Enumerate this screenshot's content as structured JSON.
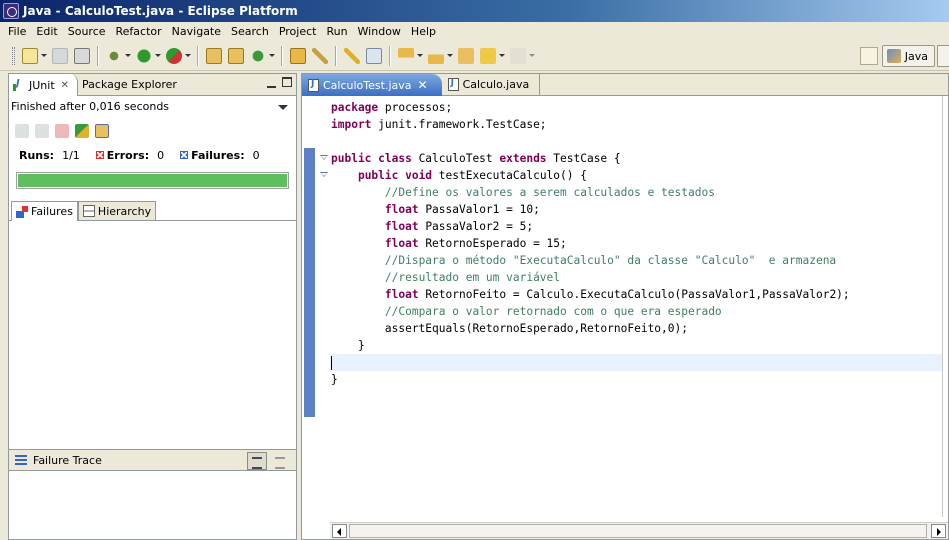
{
  "window": {
    "title": "Java - CalculoTest.java - Eclipse Platform"
  },
  "menu": [
    "File",
    "Edit",
    "Source",
    "Refactor",
    "Navigate",
    "Search",
    "Project",
    "Run",
    "Window",
    "Help"
  ],
  "perspective": {
    "label": "Java"
  },
  "left_view": {
    "tabs": [
      "JUnit",
      "Package Explorer"
    ],
    "status": "Finished after 0,016 seconds",
    "runs_label": "Runs:",
    "runs_value": "1/1",
    "errors_label": "Errors:",
    "errors_value": "0",
    "failures_label": "Failures:",
    "failures_value": "0",
    "progress_fraction": 1.0,
    "progress_color": "#5fbf5f",
    "sub_tabs": [
      "Failures",
      "Hierarchy"
    ],
    "failure_trace_label": "Failure Trace"
  },
  "editor": {
    "tabs": [
      "CalculoTest.java",
      "Calculo.java"
    ],
    "code": [
      [
        [
          "kw",
          "package"
        ],
        [
          "t",
          " processos;"
        ]
      ],
      [
        [
          "kw",
          "import"
        ],
        [
          "t",
          " junit.framework.TestCase;"
        ]
      ],
      [],
      [
        [
          "kw",
          "public class"
        ],
        [
          "t",
          " CalculoTest "
        ],
        [
          "kw",
          "extends"
        ],
        [
          "t",
          " TestCase {"
        ]
      ],
      [
        [
          "t",
          "    "
        ],
        [
          "kw",
          "public void"
        ],
        [
          "t",
          " testExecutaCalculo() {"
        ]
      ],
      [
        [
          "t",
          "        "
        ],
        [
          "cm",
          "//Define os valores a serem calculados e testados"
        ]
      ],
      [
        [
          "t",
          "        "
        ],
        [
          "kw",
          "float"
        ],
        [
          "t",
          " PassaValor1 = 10;"
        ]
      ],
      [
        [
          "t",
          "        "
        ],
        [
          "kw",
          "float"
        ],
        [
          "t",
          " PassaValor2 = 5;"
        ]
      ],
      [
        [
          "t",
          "        "
        ],
        [
          "kw",
          "float"
        ],
        [
          "t",
          " RetornoEsperado = 15;"
        ]
      ],
      [
        [
          "t",
          "        "
        ],
        [
          "cm",
          "//Dispara o método \"ExecutaCalculo\" da classe \"Calculo\"  e armazena"
        ]
      ],
      [
        [
          "t",
          "        "
        ],
        [
          "cm",
          "//resultado em um variável"
        ]
      ],
      [
        [
          "t",
          "        "
        ],
        [
          "kw",
          "float"
        ],
        [
          "t",
          " RetornoFeito = Calculo.ExecutaCalculo(PassaValor1,PassaValor2);"
        ]
      ],
      [
        [
          "t",
          "        "
        ],
        [
          "cm",
          "//Compara o valor retornado com o que era esperado"
        ]
      ],
      [
        [
          "t",
          "        assertEquals(RetornoEsperado,RetornoFeito,0);"
        ]
      ],
      [
        [
          "t",
          "    }"
        ]
      ],
      [],
      [
        [
          "t",
          "}"
        ]
      ]
    ],
    "current_line": 15
  }
}
